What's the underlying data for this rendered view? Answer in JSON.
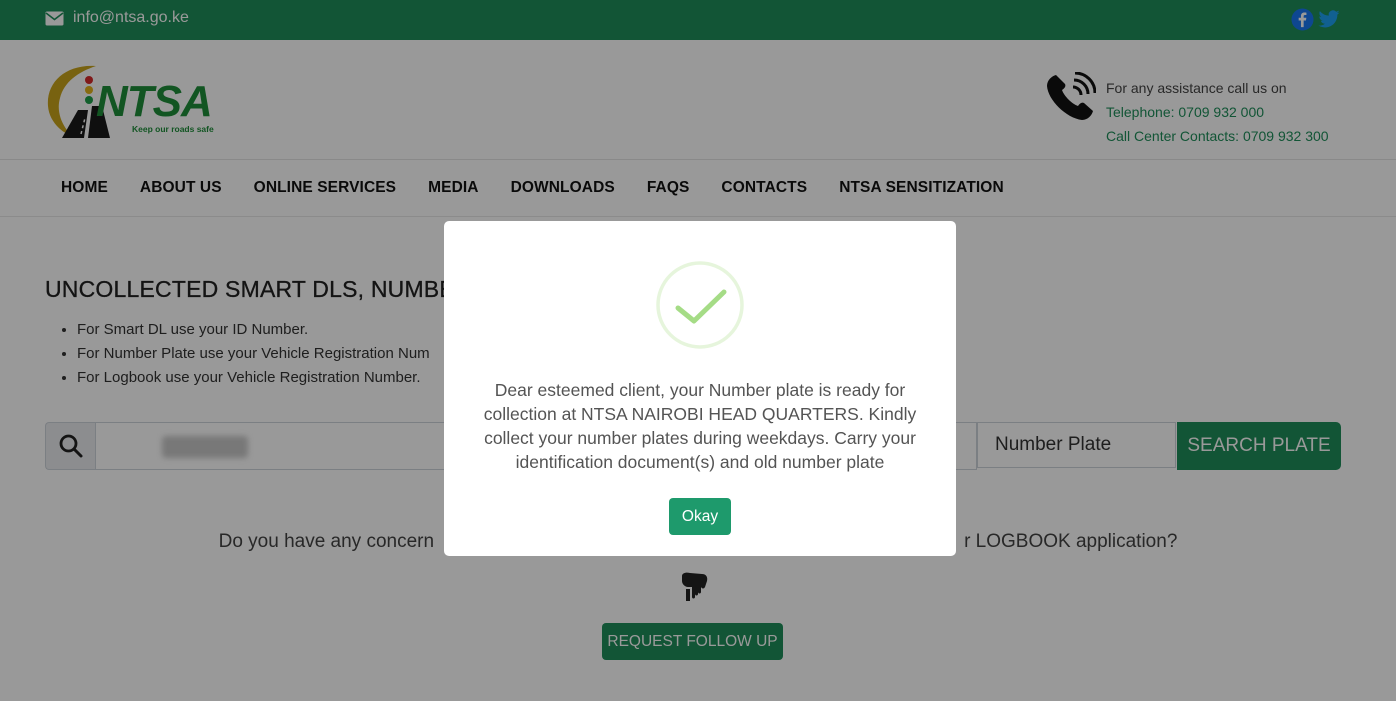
{
  "topbar": {
    "email": "info@ntsa.go.ke",
    "icons": [
      "mail-icon",
      "facebook-icon",
      "twitter-icon"
    ]
  },
  "header": {
    "logo_text": "NTSA",
    "logo_tagline": "Keep our roads safe",
    "assist_label": "For any assistance call us on",
    "telephone": "Telephone: 0709 932 000",
    "call_center": "Call Center Contacts: 0709 932 300"
  },
  "nav": {
    "items": [
      "HOME",
      "ABOUT US",
      "ONLINE SERVICES",
      "MEDIA",
      "DOWNLOADS",
      "FAQS",
      "CONTACTS",
      "NTSA SENSITIZATION"
    ]
  },
  "main": {
    "title": "UNCOLLECTED SMART DLS, NUMBER",
    "tips": [
      "For Smart DL use your ID Number.",
      "For Number Plate use your Vehicle Registration Num",
      "For Logbook use your Vehicle Registration Number."
    ],
    "search_type": "Number Plate",
    "search_button": "SEARCH PLATE",
    "concern_left": "Do you have any concern",
    "concern_right": "r LOGBOOK application?",
    "followup_button": "REQUEST FOLLOW UP"
  },
  "modal": {
    "message": "Dear esteemed client, your Number plate is ready for collection at NTSA NAIROBI HEAD QUARTERS. Kindly collect your number plates during weekdays. Carry your identification document(s) and old number plate",
    "ok_button": "Okay"
  },
  "colors": {
    "brand_green": "#1e8e5a",
    "success_check": "#a5dc86"
  }
}
